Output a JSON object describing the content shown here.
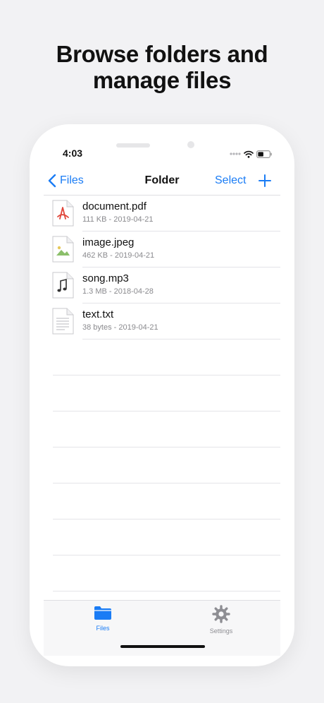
{
  "headline": {
    "line1": "Browse folders and",
    "line2": "manage files"
  },
  "status_bar": {
    "time": "4:03"
  },
  "nav": {
    "back_label": "Files",
    "title": "Folder",
    "select_label": "Select"
  },
  "files": [
    {
      "name": "document.pdf",
      "meta": "111 KB - 2019-04-21",
      "icon": "pdf-icon"
    },
    {
      "name": "image.jpeg",
      "meta": "462 KB - 2019-04-21",
      "icon": "image-icon"
    },
    {
      "name": "song.mp3",
      "meta": "1.3 MB - 2018-04-28",
      "icon": "music-icon"
    },
    {
      "name": "text.txt",
      "meta": "38 bytes - 2019-04-21",
      "icon": "text-file-icon"
    }
  ],
  "tabs": [
    {
      "label": "Files",
      "icon": "folder-icon",
      "active": true
    },
    {
      "label": "Settings",
      "icon": "gear-icon",
      "active": false
    }
  ],
  "colors": {
    "accent": "#1a7cf5",
    "inactive": "#8e8e93",
    "pdf": "#e0453a",
    "image": "#8bbf6a"
  }
}
